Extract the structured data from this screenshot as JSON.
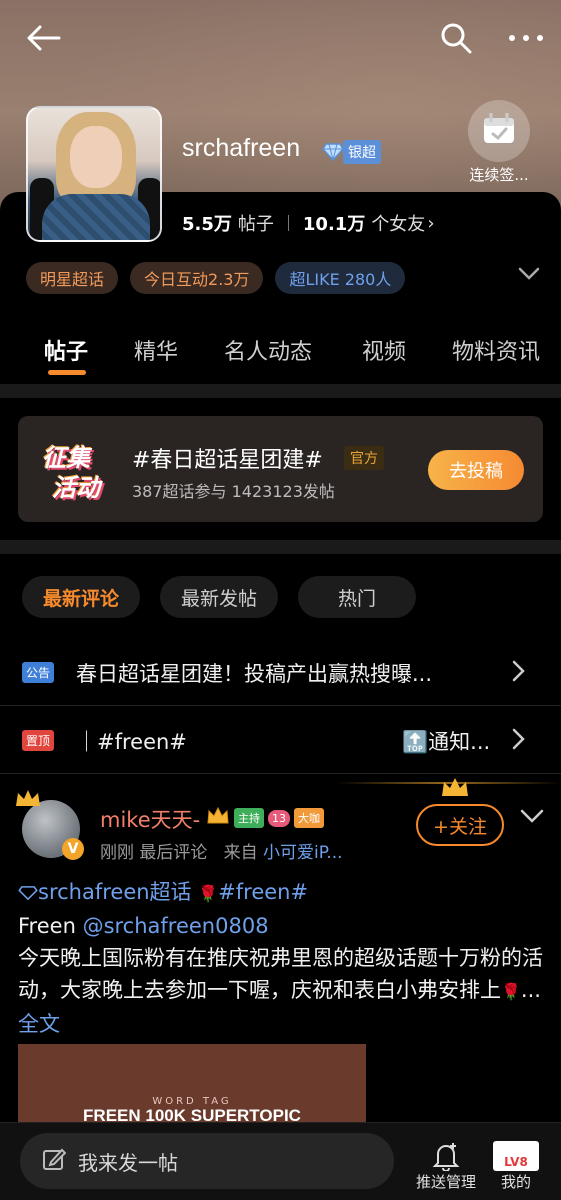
{
  "header": {
    "username": "srchafreen",
    "rank_label": "银超",
    "checkin_label": "连续签...",
    "stats": {
      "posts_value": "5.5万",
      "posts_label": "帖子",
      "fans_value": "10.1万",
      "fans_label": "个女友",
      "fans_arrow": "›"
    }
  },
  "chips": [
    {
      "label": "明星超话"
    },
    {
      "label": "今日互动2.3万"
    },
    {
      "label": "超LIKE 280人"
    }
  ],
  "tabs": [
    {
      "label": "帖子"
    },
    {
      "label": "精华"
    },
    {
      "label": "名人动态"
    },
    {
      "label": "视频"
    },
    {
      "label": "物料资讯"
    }
  ],
  "promo": {
    "logo_line1": "征集",
    "logo_line2": "活动",
    "title": "#春日超话星团建#",
    "official": "官方",
    "subtitle": "387超话参与 1423123发帖",
    "button": "去投稿"
  },
  "sort": [
    {
      "label": "最新评论"
    },
    {
      "label": "最新发帖"
    },
    {
      "label": "热门"
    }
  ],
  "notices": [
    {
      "tag": "公告",
      "tag_color": "#3f7fd8",
      "text": "春日超话星团建！投稿产出赢热搜曝..."
    },
    {
      "tag": "置顶",
      "tag_color": "#e0463d",
      "text": "｜#freen#",
      "right_text": "🔝通知..."
    }
  ],
  "post": {
    "author": "mike天天-",
    "badge_host": "主持",
    "badge_lv": "13",
    "badge_big": "大咖",
    "v_mark": "V",
    "meta_time": "刚刚 最后评论",
    "meta_from": "来自",
    "meta_source": "小可爱iP...",
    "follow": "+关注",
    "topic1": "srchafreen超话",
    "topic2": "#freen#",
    "line1_prefix": "Freen ",
    "mention": "@srchafreen0808",
    "body": "今天晚上国际粉有在推庆祝弗里恩的超级话题十万粉的活动，大家晚上去参加一下喔，庆祝和表白小弗安排上",
    "ellipsis": "...",
    "more": "全文",
    "image_small": "WORD TAG",
    "image_title": "FREEN 100K SUPERTOPIC"
  },
  "bottom": {
    "compose_placeholder": "我来发一帖",
    "push_label": "推送管理",
    "mine_label": "我的",
    "level": "LV8"
  },
  "colors": {
    "accent": "#f78a2c",
    "link": "#6fa0ea",
    "author": "#f1806b"
  }
}
